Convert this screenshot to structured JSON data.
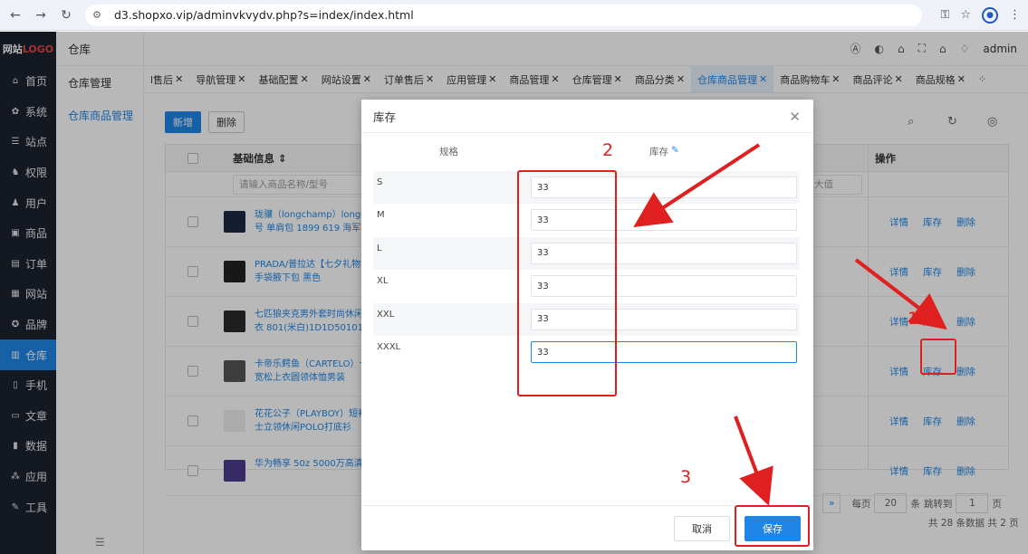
{
  "browser": {
    "url": "d3.shopxo.vip/adminvkvydv.php?s=index/index.html"
  },
  "sidebar": {
    "logo_a": "网站",
    "logo_b": "LOGO",
    "items": [
      {
        "label": "首页",
        "icon": "home-icon",
        "glyph": "⌂"
      },
      {
        "label": "系统",
        "icon": "gear-icon",
        "glyph": "✿"
      },
      {
        "label": "站点",
        "icon": "sliders-icon",
        "glyph": "☰"
      },
      {
        "label": "权限",
        "icon": "users-icon",
        "glyph": "♞"
      },
      {
        "label": "用户",
        "icon": "user-icon",
        "glyph": "♟"
      },
      {
        "label": "商品",
        "icon": "image-icon",
        "glyph": "▣"
      },
      {
        "label": "订单",
        "icon": "order-icon",
        "glyph": "▤"
      },
      {
        "label": "网站",
        "icon": "web-icon",
        "glyph": "▦"
      },
      {
        "label": "品牌",
        "icon": "brand-icon",
        "glyph": "✪"
      },
      {
        "label": "仓库",
        "icon": "warehouse-icon",
        "glyph": "▥"
      },
      {
        "label": "手机",
        "icon": "mobile-icon",
        "glyph": "▯"
      },
      {
        "label": "文章",
        "icon": "article-icon",
        "glyph": "▭"
      },
      {
        "label": "数据",
        "icon": "chart-icon",
        "glyph": "▮"
      },
      {
        "label": "应用",
        "icon": "apps-icon",
        "glyph": "⁂"
      },
      {
        "label": "工具",
        "icon": "tool-icon",
        "glyph": "✎"
      }
    ],
    "active_index": 9
  },
  "subnav": {
    "title": "仓库",
    "items": [
      "仓库管理",
      "仓库商品管理"
    ]
  },
  "topbar": {
    "user": "admin"
  },
  "tabs": [
    "l售后",
    "导航管理",
    "基础配置",
    "网站设置",
    "订单售后",
    "应用管理",
    "商品管理",
    "仓库管理",
    "商品分类",
    "仓库商品管理",
    "商品购物车",
    "商品评论",
    "商品规格"
  ],
  "content": {
    "add_label": "新增",
    "delete_label": "删除",
    "col_basic": "基础信息 ⇕",
    "col_ops": "操作",
    "search_placeholder": "请输入商品名称/型号",
    "max_placeholder": "大值",
    "rows": [
      {
        "name": "珑骧（longchamp）longch 号 单肩包 1899 619 海军蓝"
      },
      {
        "name": "PRADA/普拉达【七夕礼物 obo手袋腋下包 黑色"
      },
      {
        "name": "七匹狼夹克男外套时尚休闲 上衣 801(米白)1D1D50101"
      },
      {
        "name": "卡帝乐鳄鱼（CARTELO）卡 士宽松上衣圆领体恤男装"
      },
      {
        "name": "花花公子（PLAYBOY）短袖 男士立领休闲POLO打底衫"
      },
      {
        "name": "华为畅享 50z 5000万高清A"
      }
    ],
    "op_detail": "详情",
    "op_stock": "库存",
    "op_delete": "删除",
    "pager": {
      "next": "»",
      "per_page_label": "每页",
      "per_page": "20",
      "per_unit": "条",
      "jump_label": "跳转到",
      "jump_page": "1",
      "page_unit": "页",
      "summary": "共 28 条数据  共 2 页"
    }
  },
  "modal": {
    "title": "库存",
    "col_spec": "规格",
    "col_stock": "库存",
    "specs": [
      {
        "label": "S",
        "value": "33"
      },
      {
        "label": "M",
        "value": "33"
      },
      {
        "label": "L",
        "value": "33"
      },
      {
        "label": "XL",
        "value": "33"
      },
      {
        "label": "XXL",
        "value": "33"
      },
      {
        "label": "XXXL",
        "value": "33"
      }
    ],
    "cancel_label": "取消",
    "save_label": "保存"
  },
  "annotations": {
    "n1": "1",
    "n2": "2",
    "n3": "3",
    "color": "#e02020"
  }
}
